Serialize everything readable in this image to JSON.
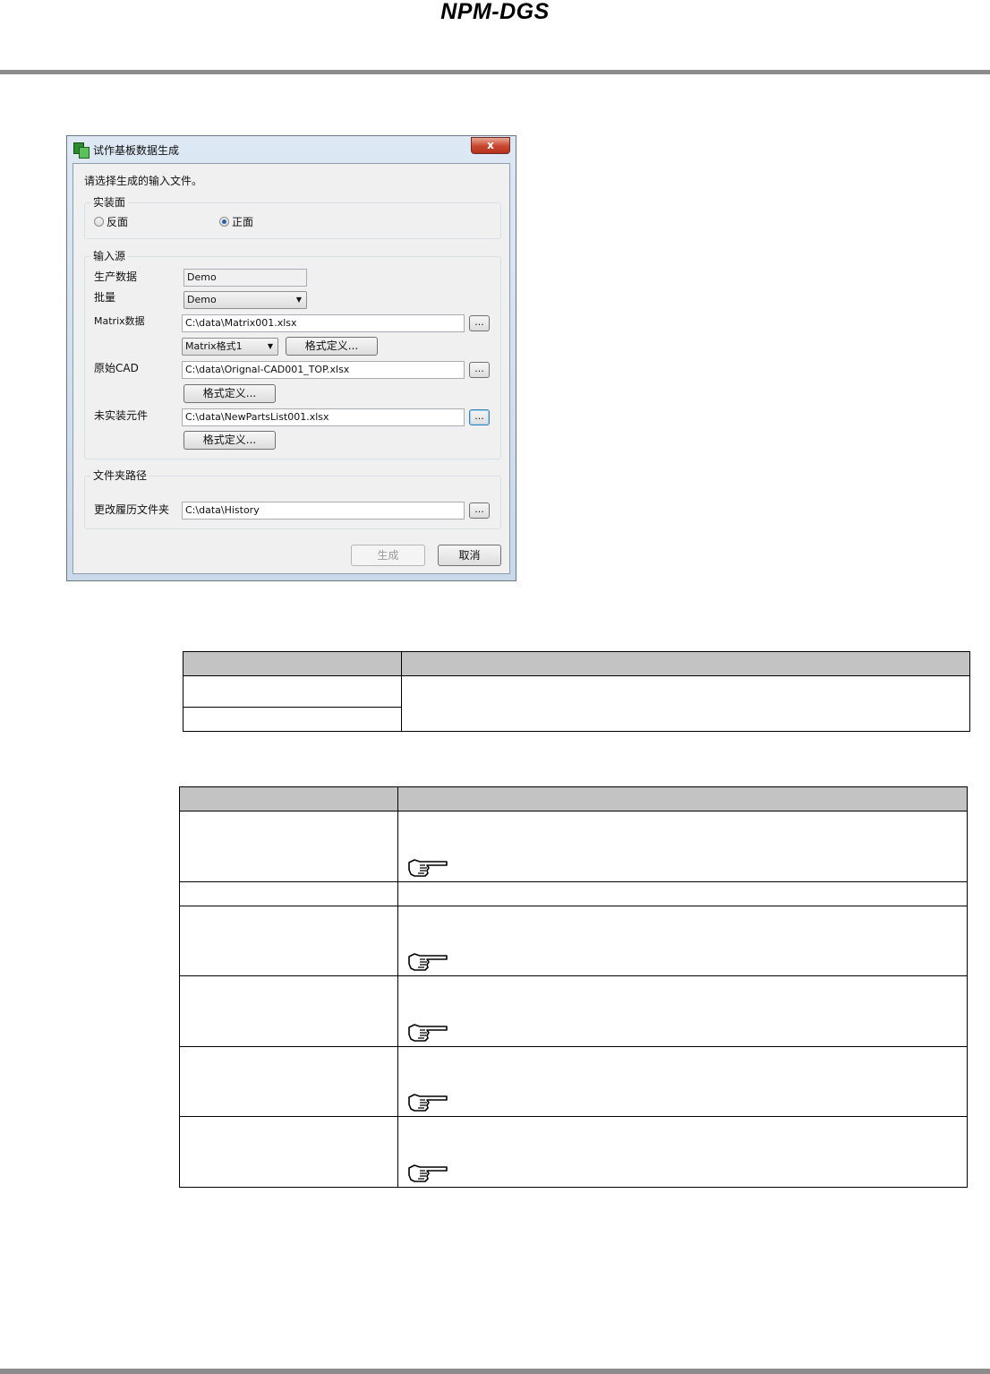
{
  "header": {
    "brand": "NPM-DGS"
  },
  "dialog": {
    "title": "试作基板数据生成",
    "close_label": "x",
    "prompt": "请选择生成的输入文件。",
    "mount_side": {
      "legend": "实装面",
      "options": [
        {
          "label": "反面",
          "checked": false
        },
        {
          "label": "正面",
          "checked": true
        }
      ]
    },
    "input_source": {
      "legend": "输入源",
      "production_data": {
        "label": "生产数据",
        "value": "Demo"
      },
      "lot": {
        "label": "批量",
        "value": "Demo"
      },
      "matrix": {
        "label": "Matrix数据",
        "path": "C:\\data\\Matrix001.xlsx",
        "format_select": "Matrix格式1",
        "format_button": "格式定义..."
      },
      "original_cad": {
        "label": "原始CAD",
        "path": "C:\\data\\Orignal-CAD001_TOP.xlsx",
        "format_button": "格式定义..."
      },
      "unmounted_parts": {
        "label": "未实装元件",
        "path": "C:\\data\\NewPartsList001.xlsx",
        "format_button": "格式定义..."
      },
      "browse_label": "..."
    },
    "folder_path": {
      "legend": "文件夹路径",
      "history": {
        "label": "更改履历文件夹",
        "path": "C:\\data\\History"
      }
    },
    "generate_label": "生成",
    "cancel_label": "取消"
  },
  "table1": {
    "rows": 2
  },
  "table2": {
    "rows": 6,
    "reference_icon": "pointing-hand-icon"
  }
}
